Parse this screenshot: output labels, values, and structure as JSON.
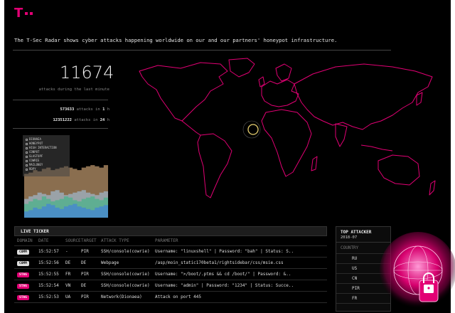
{
  "brand": {
    "color": "#e20074",
    "logo": "T · ·"
  },
  "tagline": "The T-Sec Radar shows cyber attacks happening worldwide on our and our partners' honeypot infrastructure.",
  "stats": {
    "big_number": "11674",
    "big_label": "attacks during the last minute",
    "hour_value": "573633",
    "hour_text": "attacks in",
    "hour_unit": "1",
    "hour_suffix": "h",
    "day_value": "12351222",
    "day_text": "attacks in",
    "day_unit": "24",
    "day_suffix": "h"
  },
  "legend": {
    "items": [
      "DIONAEA",
      "HONEYPOT",
      "HIGH INTERACTION",
      "CONPOT",
      "GLASTOPF",
      "COWRIE",
      "MAILONEY",
      "RDPY"
    ]
  },
  "chart_data": {
    "type": "area",
    "series_colors": [
      "#4a8fc4",
      "#5fae92",
      "#9aa2a8",
      "#8a6e4f"
    ],
    "samples": 20
  },
  "live_ticker": {
    "title": "LIVE TICKER",
    "columns": [
      "DOMAIN",
      "DATE",
      "SOURCE",
      "TARGET",
      "ATTACK TYPE",
      "PARAMETER"
    ],
    "rows": [
      {
        "domain": "COMM",
        "pink": false,
        "date": "15:52:57",
        "source": "-",
        "target": "PIR",
        "type": "SSH/console(cowrie)",
        "param": "Username: \"linuxshell\" | Password: \"bah\" | Status: S.."
      },
      {
        "domain": "COMM",
        "pink": false,
        "date": "15:52:56",
        "source": "DE",
        "target": "DE",
        "type": "Webpage",
        "param": "/asp/moin_static170beta1/rightsidebar/css/msie.css"
      },
      {
        "domain": "STAG",
        "pink": true,
        "date": "15:52:55",
        "source": "FR",
        "target": "PIR",
        "type": "SSH/console(cowrie)",
        "param": "Username: \">/boot/.ptms && cd /boot/\" | Password: &.."
      },
      {
        "domain": "STAG",
        "pink": true,
        "date": "15:52:54",
        "source": "VN",
        "target": "DE",
        "type": "SSH/console(cowrie)",
        "param": "Username: \"admin\" | Password: \"1234\" | Status: Succe.."
      },
      {
        "domain": "STAG",
        "pink": true,
        "date": "15:52:53",
        "source": "UA",
        "target": "PIR",
        "type": "Network(Dionaea)",
        "param": "Attack on port 445"
      }
    ]
  },
  "top_attacker": {
    "title": "TOP ATTACKER",
    "date": "2018-07",
    "column": "COUNTRY",
    "rows": [
      "RU",
      "US",
      "CN",
      "PIR",
      "FR"
    ]
  },
  "icons": {
    "globe": "globe-lock-icon",
    "lock": "lock-icon"
  }
}
